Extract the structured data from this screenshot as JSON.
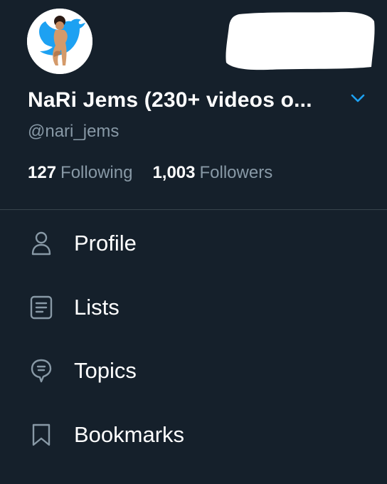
{
  "profile": {
    "display_name": "NaRi Jems (230+ videos o...",
    "handle": "@nari_jems"
  },
  "stats": {
    "following_count": "127",
    "following_label": "Following",
    "followers_count": "1,003",
    "followers_label": "Followers"
  },
  "menu": {
    "items": [
      {
        "label": "Profile",
        "icon": "person-icon"
      },
      {
        "label": "Lists",
        "icon": "list-icon"
      },
      {
        "label": "Topics",
        "icon": "topics-icon"
      },
      {
        "label": "Bookmarks",
        "icon": "bookmark-icon"
      }
    ]
  },
  "colors": {
    "background": "#15202b",
    "accent": "#1da1f2",
    "secondary_text": "#8899a6",
    "divider": "#38444d"
  }
}
